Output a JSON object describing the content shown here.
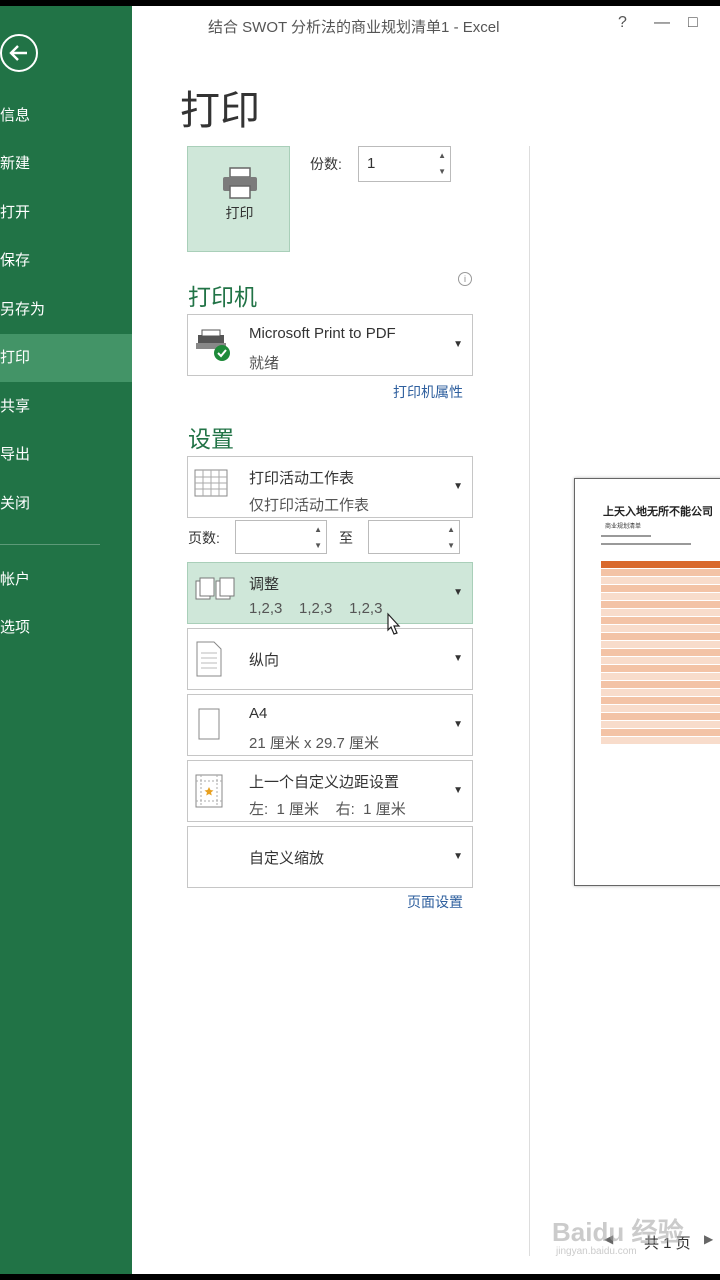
{
  "window": {
    "title": "结合 SWOT 分析法的商业规划清单1 - Excel",
    "help_label": "?",
    "minimize_label": "—",
    "restore_label": "□"
  },
  "sidebar": {
    "items": [
      {
        "label": "信息"
      },
      {
        "label": "新建"
      },
      {
        "label": "打开"
      },
      {
        "label": "保存"
      },
      {
        "label": "另存为"
      },
      {
        "label": "打印"
      },
      {
        "label": "共享"
      },
      {
        "label": "导出"
      },
      {
        "label": "关闭"
      },
      {
        "label": "帐户"
      },
      {
        "label": "选项"
      }
    ],
    "active_index": 5,
    "bg_color": "#217346"
  },
  "main": {
    "title": "打印",
    "print_button_label": "打印",
    "copies_label": "份数:",
    "copies_value": "1",
    "printer_heading": "打印机",
    "printer": {
      "name": "Microsoft Print to PDF",
      "status": "就绪"
    },
    "printer_properties_link": "打印机属性",
    "settings_heading": "设置",
    "settings": [
      {
        "line1": "打印活动工作表",
        "line2": "仅打印活动工作表",
        "icon": "worksheet-icon"
      },
      {
        "line1": "调整",
        "line2": "1,2,3    1,2,3    1,2,3",
        "icon": "collate-icon"
      },
      {
        "line1": "纵向",
        "line2": "",
        "icon": "portrait-icon"
      },
      {
        "line1": "A4",
        "line2": "21 厘米 x 29.7 厘米",
        "icon": "paper-size-icon"
      },
      {
        "line1": "上一个自定义边距设置",
        "line2": "左:  1 厘米    右:  1 厘米",
        "icon": "margins-icon"
      },
      {
        "line1": "自定义缩放",
        "line2": "",
        "icon": "scaling-icon"
      }
    ],
    "pages_label": "页数:",
    "pages_to_label": "至",
    "page_setup_link": "页面设置",
    "accent_color": "#217346"
  },
  "preview": {
    "title": "上天入地无所不能公司",
    "subtitle": "商业规划清单",
    "pager_text": "共 1 页",
    "watermark": "Baidu 经验",
    "watermark_sub": "jingyan.baidu.com"
  }
}
